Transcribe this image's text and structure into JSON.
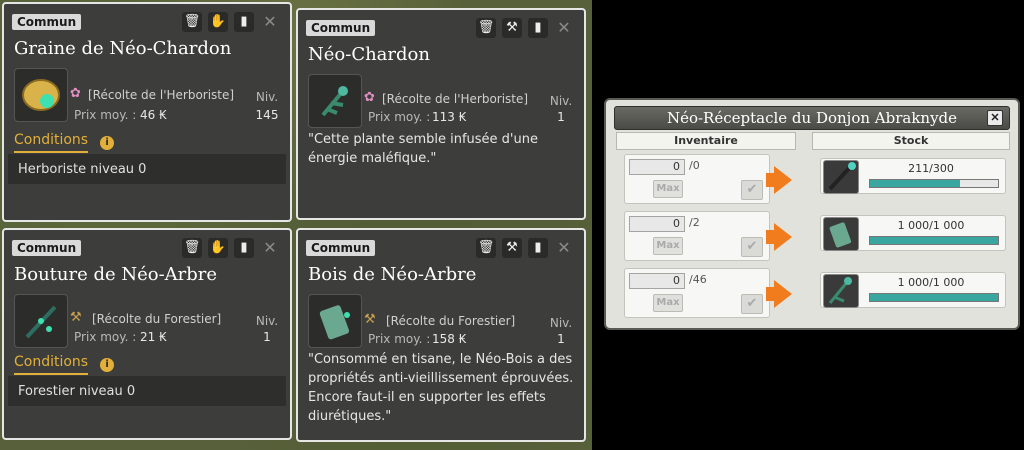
{
  "cards": {
    "graine": {
      "rarity": "Commun",
      "title": "Graine de Néo-Chardon",
      "category": "[Récolte de l'Herboriste]",
      "price_label": "Prix moy. :",
      "price": "46",
      "level_label": "Niv.",
      "level": "145",
      "conditions_tab": "Conditions",
      "condition_text": "Herboriste niveau 0"
    },
    "chardon": {
      "rarity": "Commun",
      "title": "Néo-Chardon",
      "category": "[Récolte de l'Herboriste]",
      "price_label": "Prix moy. :",
      "price": "113",
      "level_label": "Niv.",
      "level": "1",
      "description": "\"Cette plante semble infusée d'une énergie maléfique.\""
    },
    "bouture": {
      "rarity": "Commun",
      "title": "Bouture de Néo-Arbre",
      "category": "[Récolte du Forestier]",
      "price_label": "Prix moy. :",
      "price": "21",
      "level_label": "Niv.",
      "level": "1",
      "conditions_tab": "Conditions",
      "condition_text": "Forestier niveau 0"
    },
    "bois": {
      "rarity": "Commun",
      "title": "Bois de Néo-Arbre",
      "category": "[Récolte du Forestier]",
      "price_label": "Prix moy. :",
      "price": "158",
      "level_label": "Niv.",
      "level": "1",
      "description": "\"Consommé en tisane, le Néo-Bois a des propriétés anti-vieillissement éprouvées. Encore faut-il en supporter les effets diurétiques.\""
    }
  },
  "kamas_symbol": "₭",
  "stock_window": {
    "title": "Néo-Réceptacle du Donjon Abraknyde",
    "inventory_header": "Inventaire",
    "stock_header": "Stock",
    "max_label": "Max",
    "rows": [
      {
        "qty": "0",
        "max": "/0",
        "stock": "211/300",
        "fill": 0.703
      },
      {
        "qty": "0",
        "max": "/2",
        "stock": "1 000/1 000",
        "fill": 1.0
      },
      {
        "qty": "0",
        "max": "/46",
        "stock": "1 000/1 000",
        "fill": 1.0
      }
    ]
  },
  "colors": {
    "accent": "#e2b03a",
    "progress": "#3aa6a0",
    "arrow": "#f07c1e"
  }
}
